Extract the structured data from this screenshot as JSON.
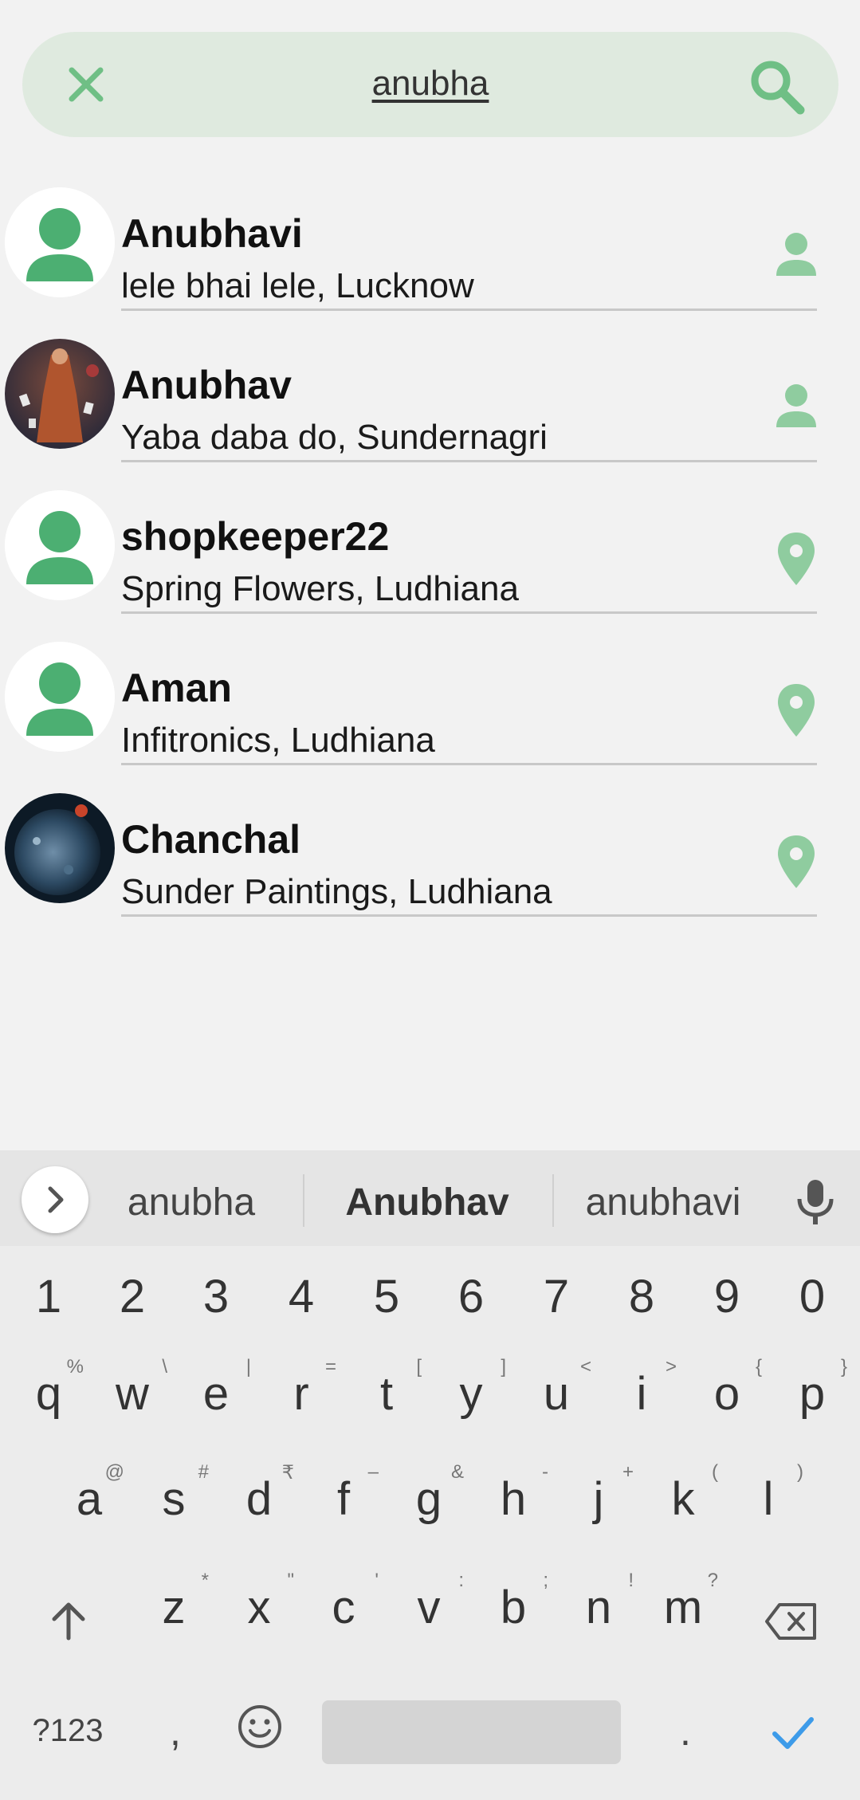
{
  "search": {
    "query": "anubha",
    "close_icon": "close-icon",
    "search_icon": "search-icon",
    "accent": "#6fbf85",
    "bar_color": "#dfeadf"
  },
  "results": [
    {
      "name": "Anubhavi",
      "subtitle": "lele bhai lele, Lucknow",
      "avatar": "default-avatar",
      "action_icon": "person-icon"
    },
    {
      "name": "Anubhav",
      "subtitle": "Yaba daba do, Sundernagri",
      "avatar": "photo-avatar",
      "action_icon": "person-icon"
    },
    {
      "name": "shopkeeper22",
      "subtitle": "Spring Flowers, Ludhiana",
      "avatar": "default-avatar",
      "action_icon": "location-pin-icon"
    },
    {
      "name": "Aman",
      "subtitle": "Infitronics, Ludhiana",
      "avatar": "default-avatar",
      "action_icon": "location-pin-icon"
    },
    {
      "name": "Chanchal",
      "subtitle": "Sunder Paintings, Ludhiana",
      "avatar": "photo-avatar",
      "action_icon": "location-pin-icon"
    }
  ],
  "keyboard": {
    "suggestions": [
      "anubha",
      "Anubhav",
      "anubhavi"
    ],
    "number_row": [
      "1",
      "2",
      "3",
      "4",
      "5",
      "6",
      "7",
      "8",
      "9",
      "0"
    ],
    "row1": [
      {
        "key": "q",
        "alt": "%"
      },
      {
        "key": "w",
        "alt": "\\"
      },
      {
        "key": "e",
        "alt": "|"
      },
      {
        "key": "r",
        "alt": "="
      },
      {
        "key": "t",
        "alt": "["
      },
      {
        "key": "y",
        "alt": "]"
      },
      {
        "key": "u",
        "alt": "<"
      },
      {
        "key": "i",
        "alt": ">"
      },
      {
        "key": "o",
        "alt": "{"
      },
      {
        "key": "p",
        "alt": "}"
      }
    ],
    "row2": [
      {
        "key": "a",
        "alt": "@"
      },
      {
        "key": "s",
        "alt": "#"
      },
      {
        "key": "d",
        "alt": "₹"
      },
      {
        "key": "f",
        "alt": "–"
      },
      {
        "key": "g",
        "alt": "&"
      },
      {
        "key": "h",
        "alt": "-"
      },
      {
        "key": "j",
        "alt": "+"
      },
      {
        "key": "k",
        "alt": "("
      },
      {
        "key": "l",
        "alt": ")"
      }
    ],
    "row3": [
      {
        "key": "z",
        "alt": "*"
      },
      {
        "key": "x",
        "alt": "\""
      },
      {
        "key": "c",
        "alt": "'"
      },
      {
        "key": "v",
        "alt": ":"
      },
      {
        "key": "b",
        "alt": ";"
      },
      {
        "key": "n",
        "alt": "!"
      },
      {
        "key": "m",
        "alt": "?"
      }
    ],
    "symbols_label": "?123",
    "comma": ",",
    "period": ".",
    "enter_color": "#3d9be9"
  }
}
